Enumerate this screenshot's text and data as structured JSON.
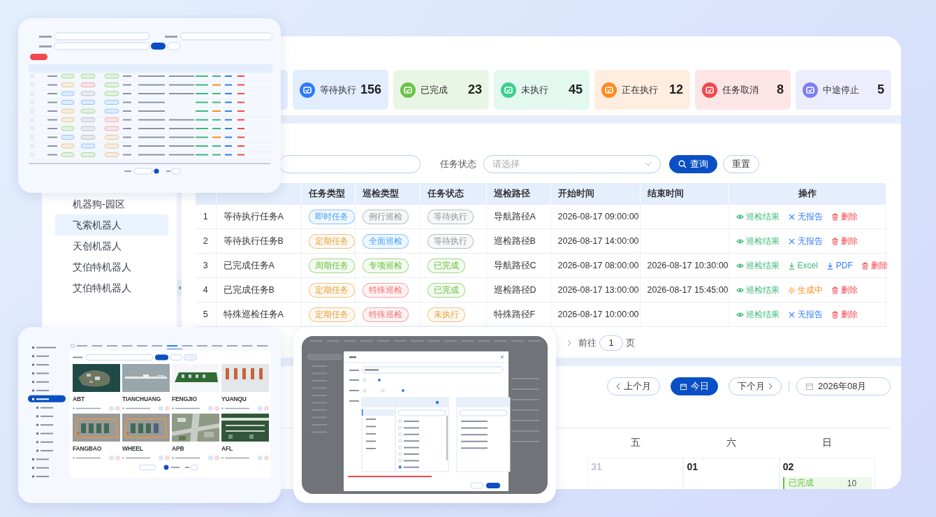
{
  "sidebar": {
    "items": [
      {
        "label": "机器狗-园区",
        "selected": false
      },
      {
        "label": "飞索机器人",
        "selected": true
      },
      {
        "label": "天创机器人",
        "selected": false
      },
      {
        "label": "艾伯特机器人",
        "selected": false
      },
      {
        "label": "艾伯特机器人",
        "selected": false
      }
    ]
  },
  "stats": [
    {
      "label": "等待执行",
      "value": "156",
      "color": "#2f7cf6"
    },
    {
      "label": "已完成",
      "value": "23",
      "color": "#6cc24a"
    },
    {
      "label": "未执行",
      "value": "45",
      "color": "#3ccf8e"
    },
    {
      "label": "正在执行",
      "value": "12",
      "color": "#ff8a1f"
    },
    {
      "label": "任务取消",
      "value": "8",
      "color": "#f2474f"
    },
    {
      "label": "中途停止",
      "value": "5",
      "color": "#7d7ef0"
    }
  ],
  "filter": {
    "status_label": "任务状态",
    "status_placeholder": "请选择",
    "query": "查询",
    "reset": "重置"
  },
  "table": {
    "columns": [
      "任务类型",
      "巡检类型",
      "任务状态",
      "巡检路径",
      "开始时间",
      "结束时间",
      "操作"
    ],
    "rows": [
      {
        "no": "1",
        "name": "等待执行任务A",
        "task_type": {
          "text": "即时任务",
          "color": "#409eff"
        },
        "inspect_type": {
          "text": "例行巡检",
          "color": "#909399"
        },
        "status": {
          "text": "等待执行",
          "color": "#909399"
        },
        "route": "导航路径A",
        "start": "2026-08-17 09:00:00",
        "actions": [
          {
            "kind": "view",
            "text": "巡检结果"
          },
          {
            "kind": "none",
            "text": "无报告"
          },
          {
            "kind": "delete",
            "text": "删除"
          }
        ]
      },
      {
        "no": "2",
        "name": "等待执行任务B",
        "task_type": {
          "text": "定期任务",
          "color": "#e6a23c"
        },
        "inspect_type": {
          "text": "全面巡检",
          "color": "#409eff"
        },
        "status": {
          "text": "等待执行",
          "color": "#909399"
        },
        "route": "巡检路径B",
        "start": "2026-08-17 14:00:00",
        "actions": [
          {
            "kind": "view",
            "text": "巡检结果"
          },
          {
            "kind": "none",
            "text": "无报告"
          },
          {
            "kind": "delete",
            "text": "删除"
          }
        ]
      },
      {
        "no": "3",
        "name": "已完成任务A",
        "task_type": {
          "text": "周期任务",
          "color": "#67c23a"
        },
        "inspect_type": {
          "text": "专项巡检",
          "color": "#67c23a"
        },
        "status": {
          "text": "已完成",
          "color": "#67c23a"
        },
        "route": "导航路径C",
        "start": "2026-08-17 08:00:00",
        "end": "2026-08-17 10:30:00",
        "actions": [
          {
            "kind": "view",
            "text": "巡检结果"
          },
          {
            "kind": "excel",
            "text": "Excel"
          },
          {
            "kind": "pdf",
            "text": "PDF"
          },
          {
            "kind": "delete",
            "text": "删除"
          }
        ]
      },
      {
        "no": "4",
        "name": "已完成任务B",
        "task_type": {
          "text": "定期任务",
          "color": "#e6a23c"
        },
        "inspect_type": {
          "text": "特殊巡检",
          "color": "#f56c6c"
        },
        "status": {
          "text": "已完成",
          "color": "#67c23a"
        },
        "route": "巡检路径D",
        "start": "2026-08-17 13:00:00",
        "end": "2026-08-17 15:45:00",
        "actions": [
          {
            "kind": "view",
            "text": "巡检结果"
          },
          {
            "kind": "generating",
            "text": "生成中"
          },
          {
            "kind": "delete",
            "text": "删除"
          }
        ]
      },
      {
        "no": "5",
        "name": "特殊巡检任务A",
        "task_type": {
          "text": "定期任务",
          "color": "#e6a23c"
        },
        "inspect_type": {
          "text": "特殊巡检",
          "color": "#f56c6c"
        },
        "status": {
          "text": "未执行",
          "color": "#e6a23c"
        },
        "route": "特殊路径F",
        "start": "2026-08-17 10:00:00",
        "actions": [
          {
            "kind": "view",
            "text": "巡检结果"
          },
          {
            "kind": "none",
            "text": "无报告"
          },
          {
            "kind": "delete",
            "text": "删除"
          }
        ]
      }
    ]
  },
  "pagination": {
    "goto_label": "前往",
    "goto_value": "1",
    "page_unit": "页"
  },
  "calendar": {
    "prev": "上个月",
    "today": "今日",
    "next": "下个月",
    "month": "2026年08月",
    "weekdays": [
      "五",
      "六",
      "日"
    ],
    "days": [
      {
        "day": "31",
        "outside": true
      },
      {
        "day": "01",
        "outside": false
      },
      {
        "day": "02",
        "outside": false,
        "events": [
          {
            "label": "已完成",
            "count": "10",
            "color": "#67c23a"
          }
        ]
      }
    ]
  },
  "scene_gallery": {
    "scenes": [
      {
        "name": "ABT"
      },
      {
        "name": "TIANCHUANG"
      },
      {
        "name": "FENGJIO"
      },
      {
        "name": "YUANQU"
      },
      {
        "name": "FANGBAO"
      },
      {
        "name": "WHEEL"
      },
      {
        "name": "APB"
      },
      {
        "name": "AFL"
      }
    ]
  }
}
